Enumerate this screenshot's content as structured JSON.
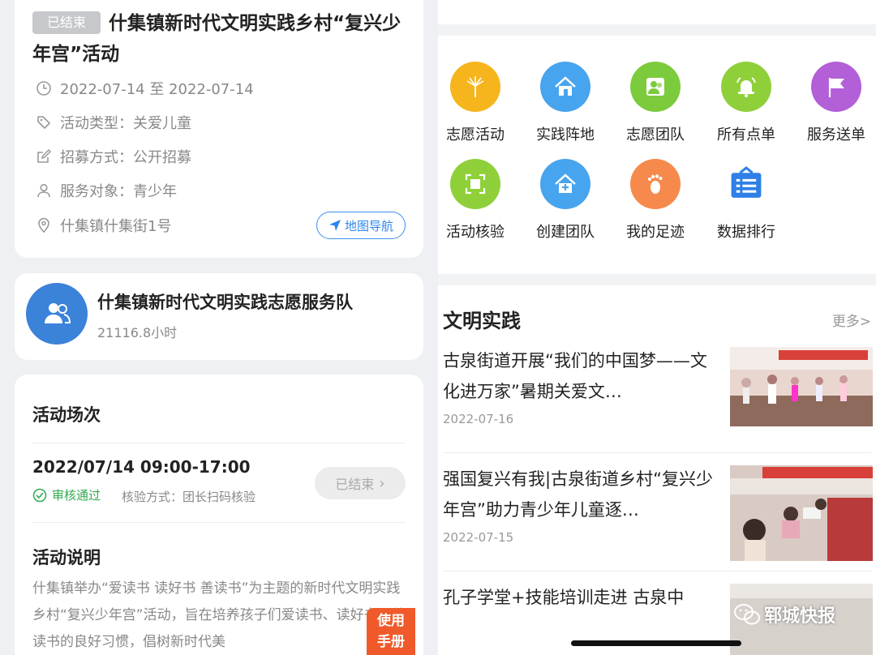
{
  "activity": {
    "status_badge": "已结束",
    "title": "什集镇新时代文明实践乡村“复兴少年宫”活动",
    "date_range": "2022-07-14 至 2022-07-14",
    "type": "活动类型：关爱儿童",
    "recruit": "招募方式：公开招募",
    "target": "服务对象：青少年",
    "address": "什集镇什集街1号",
    "map_nav_label": "地图导航"
  },
  "team": {
    "name": "什集镇新时代文明实践志愿服务队",
    "hours": "21116.8小时"
  },
  "sessions": {
    "section_title": "活动场次",
    "time": "2022/07/14  09:00-17:00",
    "audit_status": "审核通过",
    "verify_method": "核验方式：团长扫码核验",
    "ended_label": "已结束"
  },
  "description": {
    "section_title": "活动说明",
    "text": "什集镇举办“爱读书 读好书 善读书”为主题的新时代文明实践乡村“复兴少年宫”活动，旨在培养孩子们爱读书、读好书、善读书的良好习惯，倡树新时代美"
  },
  "manual_button": {
    "line1": "使用",
    "line2": "手册"
  },
  "grid": [
    {
      "label": "志愿活动",
      "icon": "palm-tree-icon",
      "color": "#f6b51c"
    },
    {
      "label": "实践阵地",
      "icon": "house-icon",
      "color": "#47a4ee"
    },
    {
      "label": "志愿团队",
      "icon": "team-icon",
      "color": "#7ccb3d"
    },
    {
      "label": "所有点单",
      "icon": "bell-icon",
      "color": "#8fd03a"
    },
    {
      "label": "服务送单",
      "icon": "flag-icon",
      "color": "#b35fd8"
    },
    {
      "label": "活动核验",
      "icon": "scan-icon",
      "color": "#8fd03a"
    },
    {
      "label": "创建团队",
      "icon": "house-plus-icon",
      "color": "#47a4ee"
    },
    {
      "label": "我的足迹",
      "icon": "footprint-icon",
      "color": "#f58a4c"
    },
    {
      "label": "数据排行",
      "icon": "list-board-icon",
      "color": "#2f7fe6"
    }
  ],
  "news": {
    "section_title": "文明实践",
    "more_label": "更多>",
    "items": [
      {
        "title": "古泉街道开展“我们的中国梦——文化进万家”暑期关爱文…",
        "date": "2022-07-16"
      },
      {
        "title": "强国复兴有我|古泉街道乡村“复兴少年宫”助力青少年儿童逐…",
        "date": "2022-07-15"
      },
      {
        "title": "孔子学堂+技能培训走进 古泉中",
        "date": ""
      }
    ]
  },
  "watermark": "郓城快报"
}
